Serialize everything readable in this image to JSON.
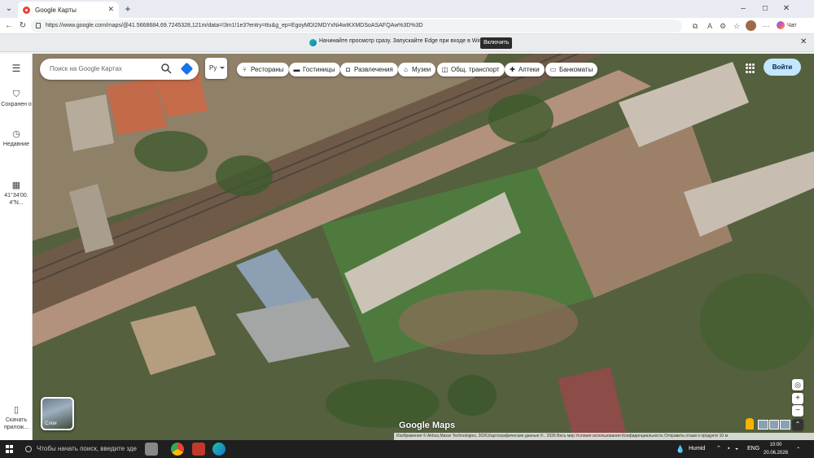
{
  "browser": {
    "tab_title": "Google Карты",
    "url": "https://www.google.com/maps/@41.5668684,69.7245328,121m/data=!3m1!1e3?entry=ttu&g_ep=EgoyMDI2MDYxNi4wIKXMDSoASAFQAw%3D%3D",
    "chat_label": "Чат"
  },
  "infobar": {
    "text": "Начинайте просмотр сразу. Запускайте Edge при входе в Windows.",
    "button": "Включить"
  },
  "sidebar": {
    "items": [
      {
        "label": "Сохранен о",
        "icon": "bookmark-icon"
      },
      {
        "label": "Недавние",
        "icon": "history-icon"
      },
      {
        "label": "41°34'00. 4\"N...",
        "icon": "place-icon"
      },
      {
        "label": "Скачать прилож...",
        "icon": "phone-icon"
      }
    ]
  },
  "search": {
    "placeholder": "Поиск на Google Картах",
    "lang": "Ру"
  },
  "chips": [
    {
      "label": "Рестораны",
      "icon": "fork-knife-icon"
    },
    {
      "label": "Гостиницы",
      "icon": "bed-icon"
    },
    {
      "label": "Развлечения",
      "icon": "camera-icon"
    },
    {
      "label": "Музеи",
      "icon": "museum-icon"
    },
    {
      "label": "Общ. транспорт",
      "icon": "transit-icon"
    },
    {
      "label": "Аптеки",
      "icon": "pharmacy-icon"
    },
    {
      "label": "Банкоматы",
      "icon": "atm-icon"
    }
  ],
  "signin": "Войти",
  "layers_label": "Слои",
  "map": {
    "logo": "Google Maps",
    "attribution": "Изображения © Airbus,Maxar Technologies, 2026,Картографические данные © , 2026   Весь мир   Условия использования   Конфиденциальность   Отправить отзыв о продукте   10 м"
  },
  "taskbar": {
    "search_placeholder": "Чтобы начать поиск, введите зде",
    "weather": "Humid",
    "lang": "ENG",
    "time": "10:00",
    "date": "20.06.2026"
  },
  "colors": {
    "signin_bg": "#c2e7ff",
    "accent": "#1a73e8"
  }
}
